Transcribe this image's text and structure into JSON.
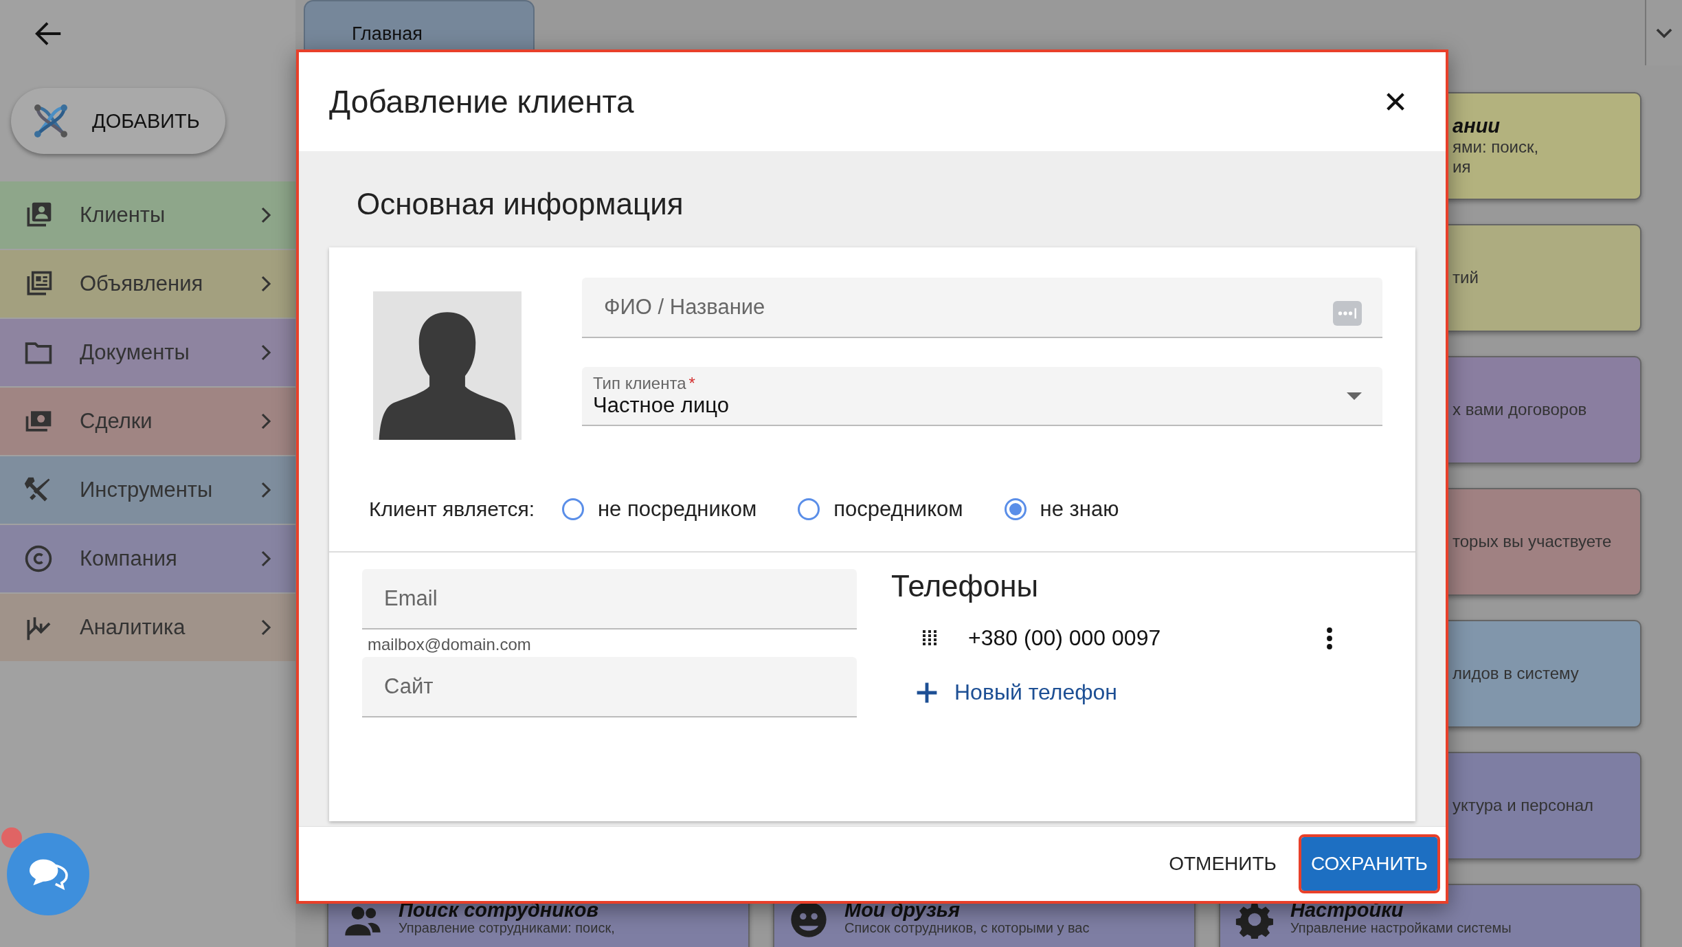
{
  "sidebar": {
    "add_button": "ДОБАВИТЬ",
    "items": [
      {
        "label": "Клиенты",
        "color": "#8ea68a"
      },
      {
        "label": "Объявления",
        "color": "#a3a07f"
      },
      {
        "label": "Документы",
        "color": "#8e84a0"
      },
      {
        "label": "Сделки",
        "color": "#a08583"
      },
      {
        "label": "Инструменты",
        "color": "#7f8e9e"
      },
      {
        "label": "Компания",
        "color": "#8784a2"
      },
      {
        "label": "Аналитика",
        "color": "#a0938a"
      }
    ]
  },
  "tabs": [
    {
      "label": "Главная",
      "selected": true
    }
  ],
  "right_cards": [
    {
      "title": "ании",
      "description": "ями: поиск,\nия",
      "color": "#b3b27e"
    },
    {
      "description": "тий",
      "color": "#adac80"
    },
    {
      "description": "х вами договоров",
      "color": "#8a7ea0"
    },
    {
      "description": "торых вы участвуете",
      "color": "#a08182"
    },
    {
      "description": "лидов в систему",
      "color": "#8196ab"
    },
    {
      "description": "уктура и персонал",
      "color": "#7e7ea3"
    }
  ],
  "bottom_cards": [
    {
      "title": "Поиск сотрудников",
      "description": "Управление сотрудниками: поиск,",
      "color": "#7e7ea3"
    },
    {
      "title": "Мои друзья",
      "description": "Список сотрудников, с которыми у вас",
      "color": "#7e7ea3"
    },
    {
      "title": "Настройки",
      "description": "Управление настройками системы",
      "color": "#7e7ea3"
    }
  ],
  "dialog": {
    "title": "Добавление клиента",
    "highlighted": true,
    "section_title": "Основная информация",
    "name_field": {
      "placeholder": "ФИО / Название"
    },
    "type_field": {
      "label": "Тип клиента",
      "required_mark": "*",
      "value": "Частное лицо"
    },
    "role": {
      "label": "Клиент является:",
      "options": [
        {
          "label": "не посредником",
          "selected": false
        },
        {
          "label": "посредником",
          "selected": false
        },
        {
          "label": "не знаю",
          "selected": true
        }
      ]
    },
    "email_field": {
      "placeholder": "Email",
      "helper": "mailbox@domain.com"
    },
    "site_field": {
      "placeholder": "Сайт"
    },
    "phones": {
      "title": "Телефоны",
      "items": [
        "+380 (00) 000 0097"
      ],
      "add_button": "Новый телефон"
    },
    "buttons": [
      {
        "label": "ОТМЕНИТЬ",
        "kind": "text",
        "highlighted": false
      },
      {
        "label": "СОХРАНИТЬ",
        "kind": "primary",
        "highlighted": true
      }
    ]
  }
}
